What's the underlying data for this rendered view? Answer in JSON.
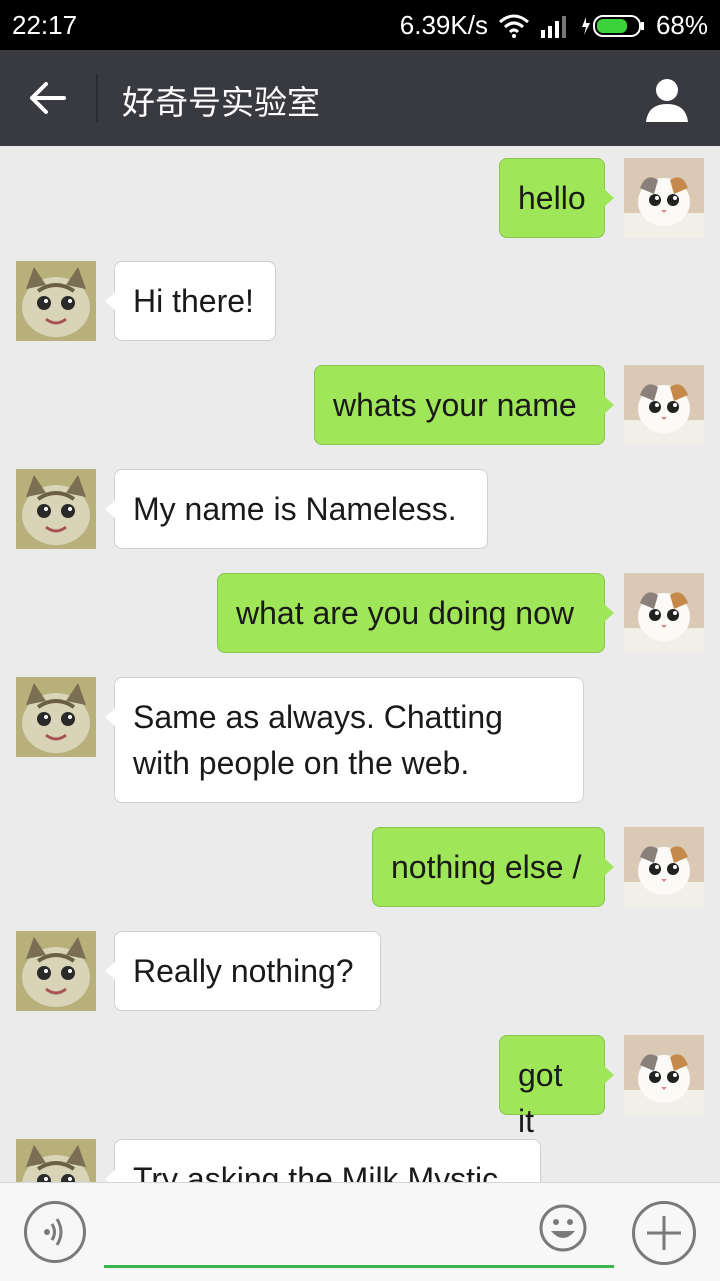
{
  "status_bar": {
    "time": "22:17",
    "network_speed": "6.39K/s",
    "battery": "68%"
  },
  "header": {
    "title": "好奇号实验室",
    "back_icon": "arrow-left-icon",
    "profile_icon": "person-icon"
  },
  "messages": [
    {
      "side": "out",
      "text": "hello"
    },
    {
      "side": "in",
      "text": "Hi there!"
    },
    {
      "side": "out",
      "text": "whats your name"
    },
    {
      "side": "in",
      "text": "My name is Nameless."
    },
    {
      "side": "out",
      "text": "what are you doing now"
    },
    {
      "side": "in",
      "text": "Same as always. Chatting with people on the web."
    },
    {
      "side": "out",
      "text": "nothing else /"
    },
    {
      "side": "in",
      "text": "Really nothing?"
    },
    {
      "side": "out",
      "text": "got it"
    },
    {
      "side": "in",
      "text": "Try asking the Milk Mystic"
    }
  ],
  "input_bar": {
    "voice_icon": "voice-icon",
    "emoji_icon": "emoji-icon",
    "plus_icon": "plus-icon",
    "input_value": ""
  },
  "colors": {
    "outgoing_bubble": "#9fe658",
    "incoming_bubble": "#ffffff",
    "header_bg": "#393a3f",
    "accent": "#3bb54a"
  }
}
